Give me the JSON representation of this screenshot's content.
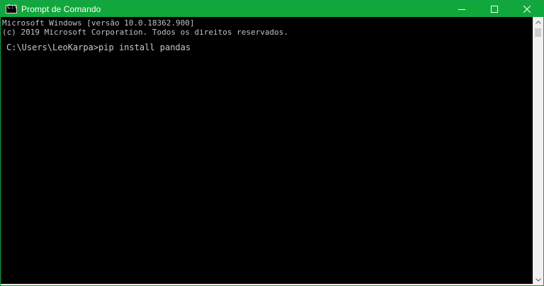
{
  "window": {
    "title": "Prompt de Comando",
    "accent": "#11a83b",
    "icon": "cmd-icon",
    "icon_glyph": "C:\\"
  },
  "controls": {
    "minimize": "minimize-icon",
    "maximize": "maximize-icon",
    "close": "close-icon"
  },
  "console": {
    "line1": "Microsoft Windows [versão 10.0.18362.900]",
    "line2": "(c) 2019 Microsoft Corporation. Todos os direitos reservados.",
    "prompt": "C:\\Users\\LeoKarpa>pip install pandas"
  }
}
